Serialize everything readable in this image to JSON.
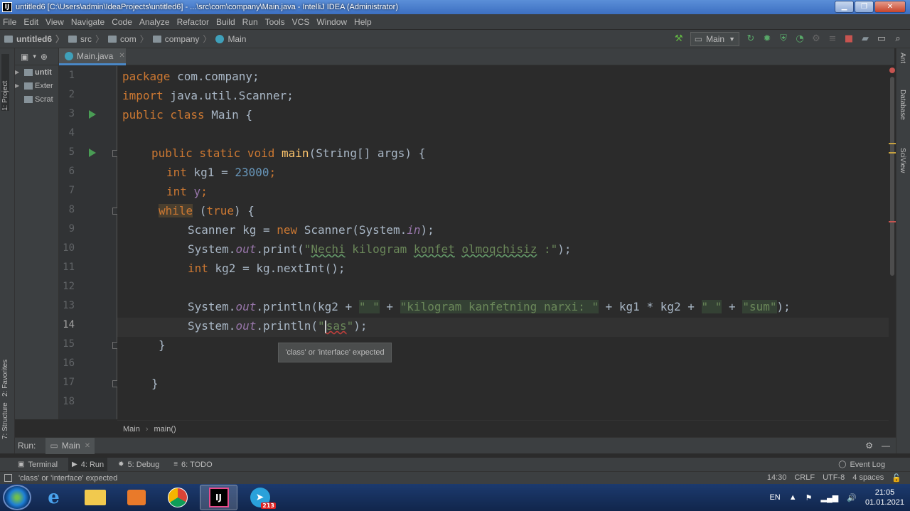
{
  "window": {
    "title": "untitled6 [C:\\Users\\admin\\IdeaProjects\\untitled6] - ...\\src\\com\\company\\Main.java - IntelliJ IDEA (Administrator)",
    "app_icon": "IJ",
    "min": "▁",
    "max": "❐",
    "close": "✕"
  },
  "menu": [
    "File",
    "Edit",
    "View",
    "Navigate",
    "Code",
    "Analyze",
    "Refactor",
    "Build",
    "Run",
    "Tools",
    "VCS",
    "Window",
    "Help"
  ],
  "nav": {
    "crumbs": [
      "untitled6",
      "src",
      "com",
      "company",
      "Main"
    ],
    "run_config": "Main"
  },
  "project_pane": {
    "items": [
      "untit",
      "Exter",
      "Scrat"
    ]
  },
  "left_tabs": {
    "project": "1: Project",
    "favorites": "2: Favorites",
    "structure": "7: Structure"
  },
  "right_tabs": {
    "ant": "Ant",
    "database": "Database",
    "sciview": "SciView"
  },
  "editor": {
    "tab": "Main.java",
    "line_numbers": [
      "1",
      "2",
      "3",
      "4",
      "5",
      "6",
      "7",
      "8",
      "9",
      "10",
      "11",
      "12",
      "13",
      "14",
      "15",
      "16",
      "17",
      "18"
    ],
    "current_line": 14,
    "tooltip": "'class' or 'interface' expected",
    "breadcrumbs": [
      "Main",
      "main()"
    ]
  },
  "code": {
    "l1a": "package",
    "l1b": " com.company;",
    "l2a": "import",
    "l2b": " java.util.Scanner;",
    "l3a": "public class",
    "l3b": " Main {",
    "l5a": "public static void",
    "l5b": "main",
    "l5c": "(String[] args) {",
    "l6a": "int",
    "l6b": " kg1 = ",
    "l6c": "23000",
    "l6d": ";",
    "l7a": "int",
    "l7b": " ",
    "l7c": "y",
    "l7d": ";",
    "l8a": "while",
    "l8b": " (",
    "l8c": "true",
    "l8d": ") {",
    "l9a": "Scanner kg = ",
    "l9b": "new",
    "l9c": " Scanner(System.",
    "l9d": "in",
    "l9e": ");",
    "l10a": "System.",
    "l10b": "out",
    "l10c": ".print(",
    "l10d": "\"",
    "l10e": "Nechi",
    "l10f": " kilogram ",
    "l10g": "konfet",
    "l10h": " ",
    "l10i": "olmoqchisiz",
    "l10j": " :\"",
    "l10k": ");",
    "l11a": "int",
    "l11b": " kg2 = kg.nextInt();",
    "l13a": "System.",
    "l13b": "out",
    "l13c": ".println(kg2 + ",
    "l13d": "\" \"",
    "l13e": " + ",
    "l13f": "\"kilogram kanfetning narxi: \"",
    "l13g": " + kg1 * kg2 + ",
    "l13h": "\" \"",
    "l13i": " + ",
    "l13j": "\"sum\"",
    "l13k": ");",
    "l14a": "System.",
    "l14b": "out",
    "l14c": ".println(",
    "l14d": "\"",
    "l14e": "sas",
    "l14f": "\"",
    "l14g": ");",
    "l15": "}",
    "l17": "}"
  },
  "run_panel": {
    "label": "Run:",
    "tab": "Main"
  },
  "tool_windows": [
    {
      "icon": "▣",
      "label": "Terminal"
    },
    {
      "icon": "▶",
      "label": "4: Run"
    },
    {
      "icon": "✹",
      "label": "5: Debug"
    },
    {
      "icon": "≡",
      "label": "6: TODO"
    }
  ],
  "event_log": "Event Log",
  "status": {
    "message": "'class' or 'interface' expected",
    "position": "14:30",
    "line_sep": "CRLF",
    "encoding": "UTF-8",
    "indent": "4 spaces"
  },
  "taskbar": {
    "lang": "EN",
    "time": "21:05",
    "date": "01.01.2021",
    "telegram_badge": "213"
  },
  "colors": {
    "keyword": "#cc7832",
    "number": "#6897bb",
    "string": "#6a8759",
    "field": "#9876aa",
    "method": "#ffc66d",
    "default": "#a9b7c6"
  }
}
